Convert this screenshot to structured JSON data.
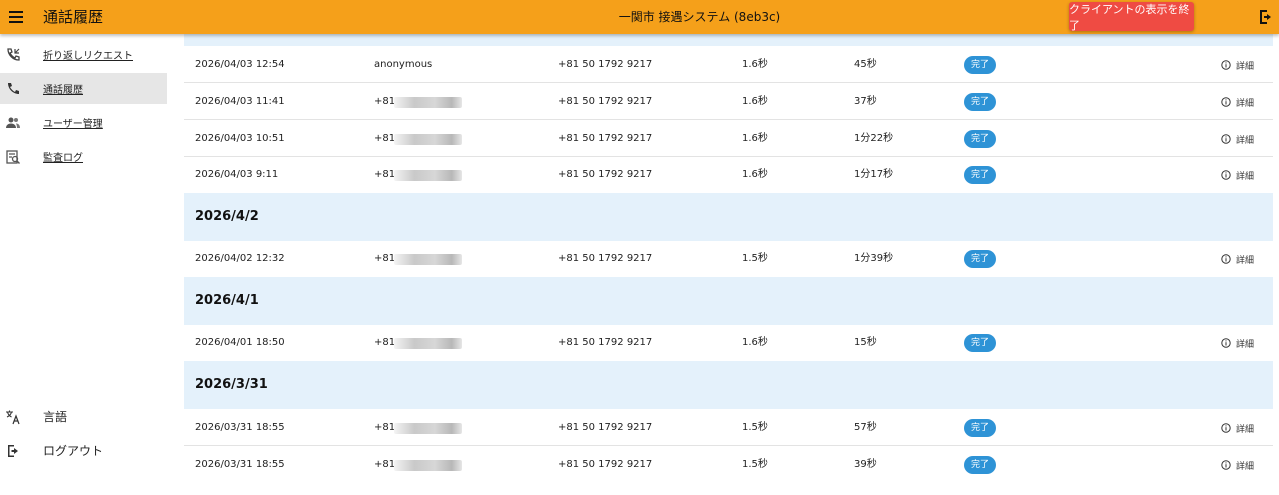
{
  "topbar": {
    "app_title": "通話履歴",
    "system_name": "一関市 接遇システム (8eb3c)",
    "end_client_button": "クライアントの表示を終了"
  },
  "sidebar": {
    "items": [
      {
        "label": "折り返しリクエスト",
        "icon": "phone-callback-icon"
      },
      {
        "label": "通話履歴",
        "icon": "phone-icon"
      },
      {
        "label": "ユーザー管理",
        "icon": "users-icon"
      },
      {
        "label": "監査ログ",
        "icon": "audit-log-icon"
      }
    ],
    "bottom": [
      {
        "label": "言語",
        "icon": "translate-icon"
      },
      {
        "label": "ログアウト",
        "icon": "logout-icon"
      }
    ]
  },
  "calls": {
    "status_label": "完了",
    "detail_label": "詳細",
    "rows": [
      {
        "datetime": "2026/04/03 12:54",
        "from": "anonymous",
        "to": "+81 50 1792 9217",
        "wait": "1.6秒",
        "duration": "45秒"
      },
      {
        "datetime": "2026/04/03 11:41",
        "from": "+81",
        "to": "+81 50 1792 9217",
        "wait": "1.6秒",
        "duration": "37秒"
      },
      {
        "datetime": "2026/04/03 10:51",
        "from": "+81",
        "to": "+81 50 1792 9217",
        "wait": "1.6秒",
        "duration": "1分22秒"
      },
      {
        "datetime": "2026/04/03 9:11",
        "from": "+81",
        "to": "+81 50 1792 9217",
        "wait": "1.6秒",
        "duration": "1分17秒"
      },
      {
        "datetime": "2026/04/02 12:32",
        "from": "+81",
        "to": "+81 50 1792 9217",
        "wait": "1.5秒",
        "duration": "1分39秒"
      },
      {
        "datetime": "2026/04/01 18:50",
        "from": "+81",
        "to": "+81 50 1792 9217",
        "wait": "1.6秒",
        "duration": "15秒"
      },
      {
        "datetime": "2026/03/31 18:55",
        "from": "+81",
        "to": "+81 50 1792 9217",
        "wait": "1.5秒",
        "duration": "57秒"
      },
      {
        "datetime": "2026/03/31 18:55",
        "from": "+81",
        "to": "+81 50 1792 9217",
        "wait": "1.5秒",
        "duration": "39秒"
      }
    ],
    "groups": [
      "2026/4/2",
      "2026/4/1",
      "2026/3/31"
    ]
  },
  "colors": {
    "topbar": "#f5a01a",
    "end_client_button": "#ef4b43",
    "status_badge": "#2e93d6",
    "group_header": "#e4f1fb"
  }
}
